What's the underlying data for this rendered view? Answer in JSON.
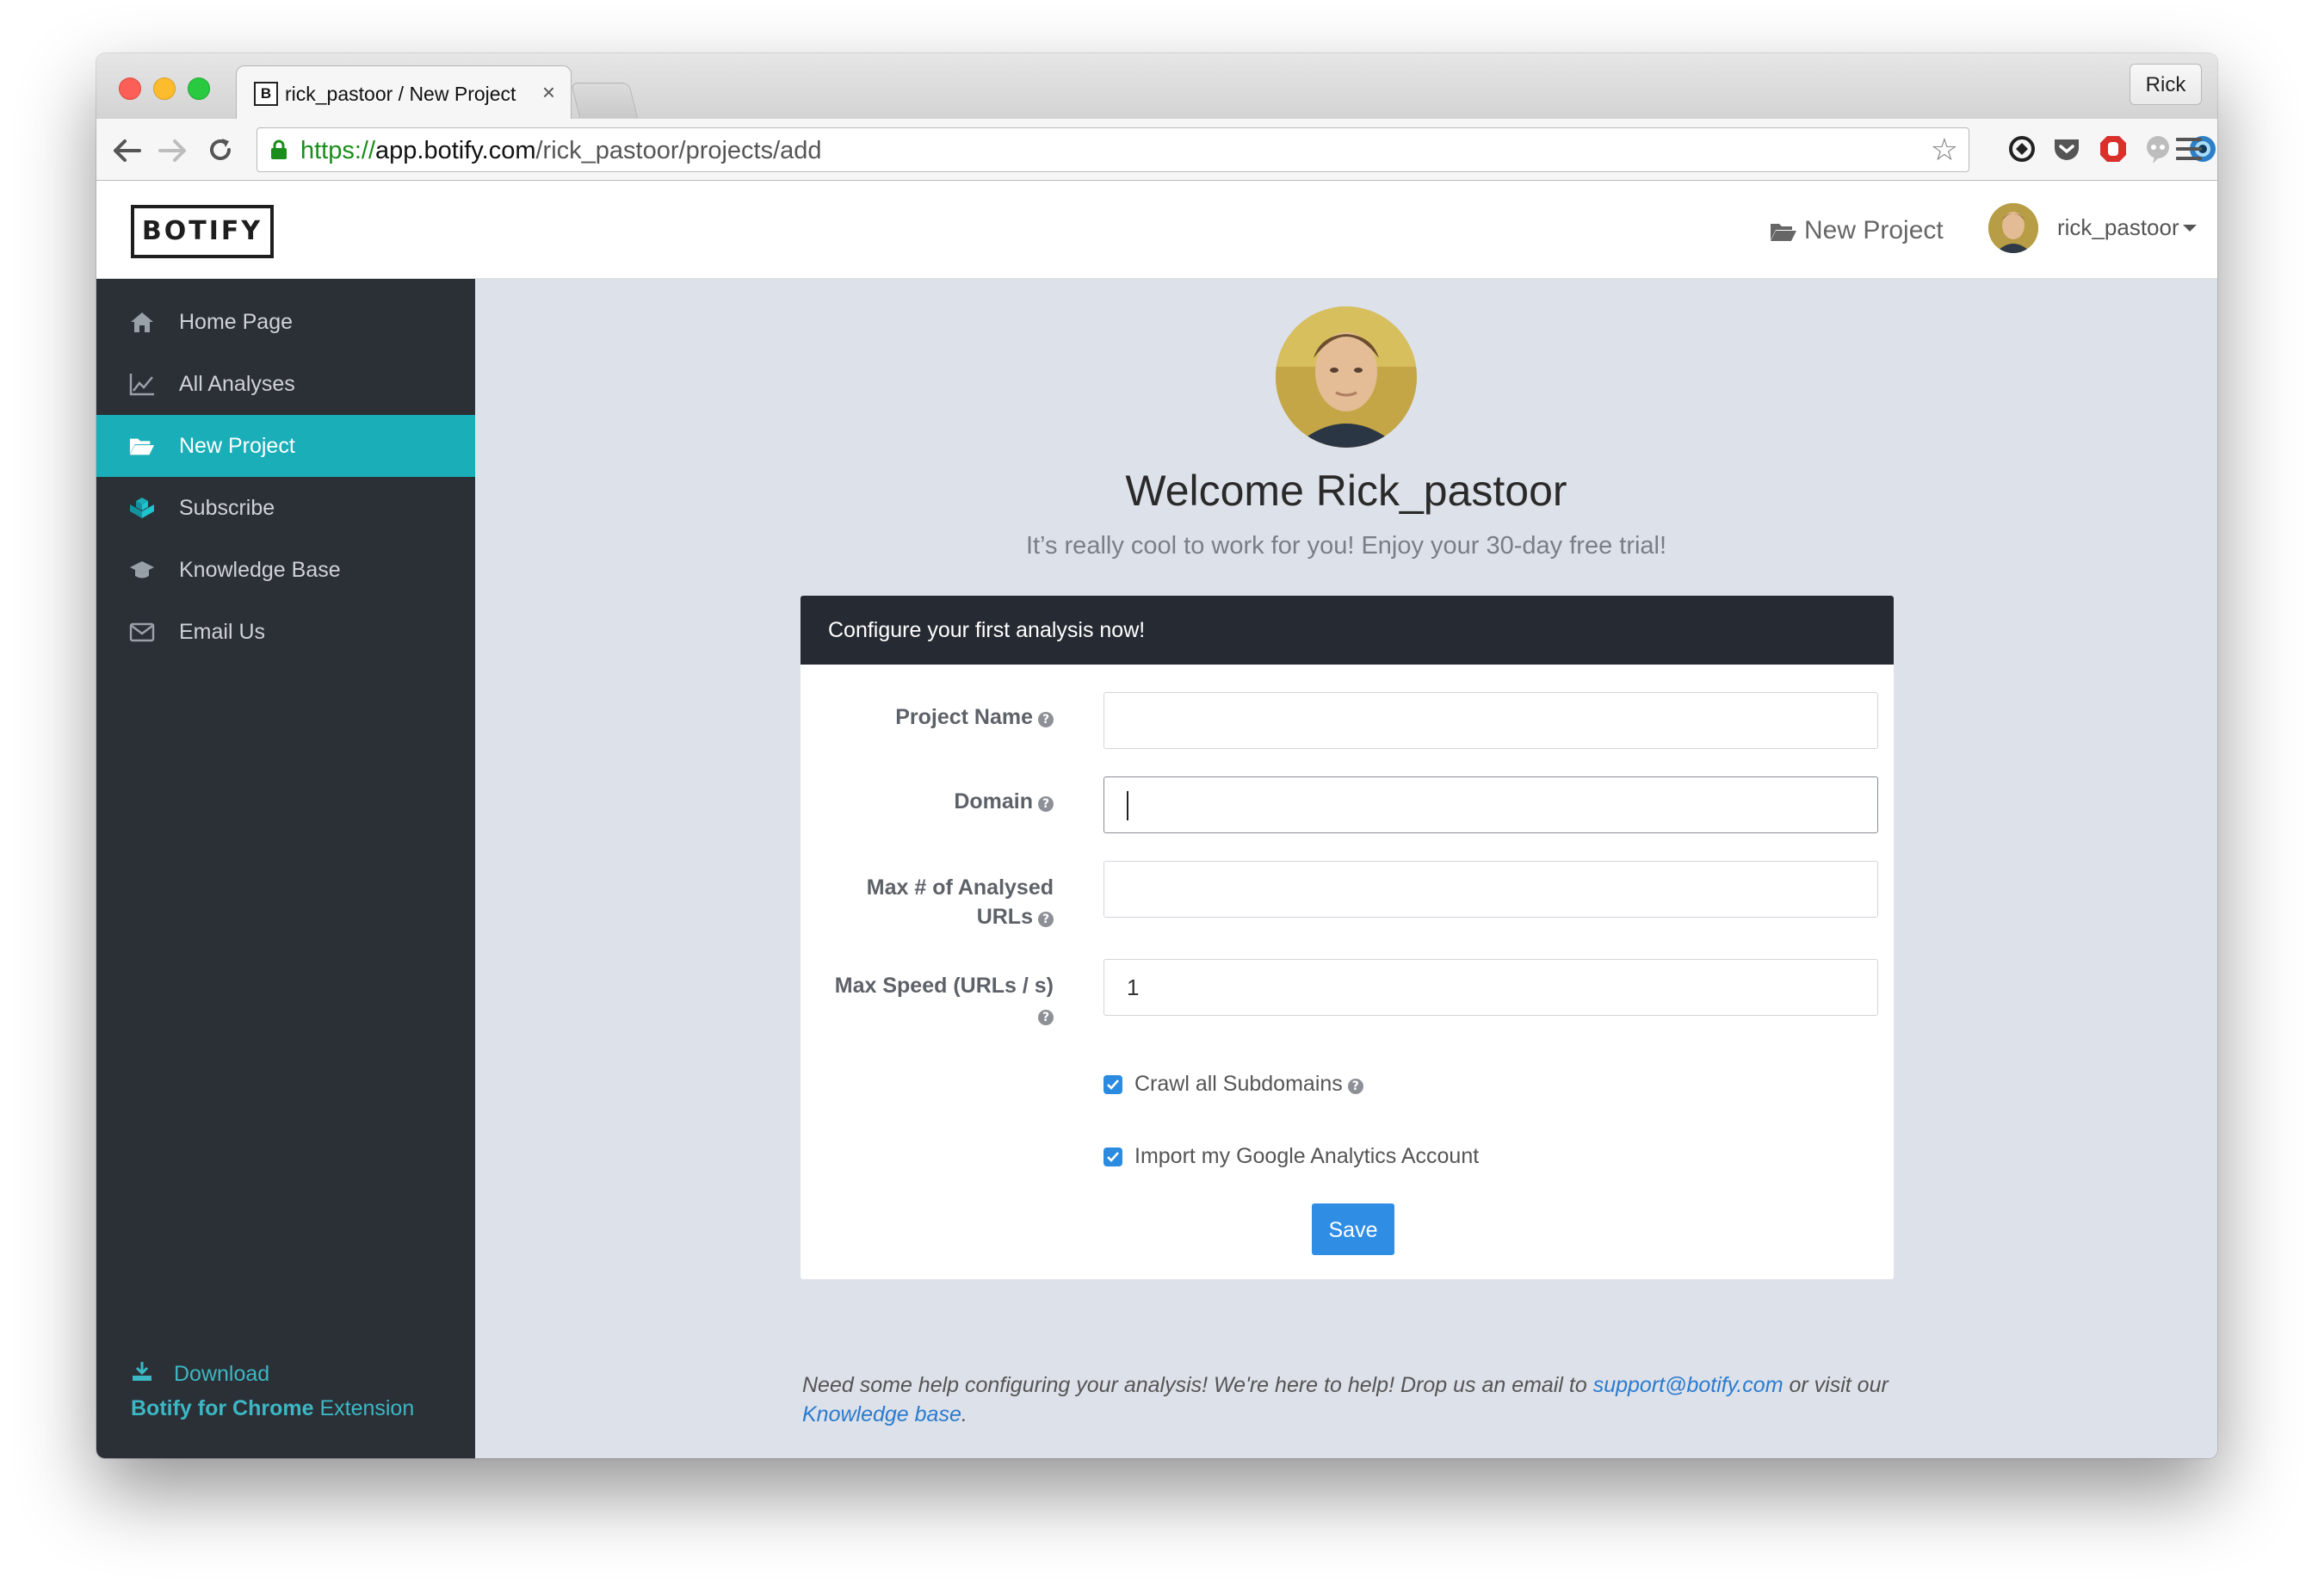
{
  "browser": {
    "tab_title": "rick_pastoor / New Project",
    "tab_favicon": "B",
    "tab_close": "×",
    "profile_name": "Rick",
    "url_scheme": "https://",
    "url_host": "app.botify.com",
    "url_path": "/rick_pastoor/projects/add",
    "star": "☆"
  },
  "header": {
    "logo": "BOTIFY",
    "new_project": "New Project",
    "username": "rick_pastoor"
  },
  "sidebar": {
    "items": [
      {
        "label": "Home Page",
        "icon": "home-icon"
      },
      {
        "label": "All Analyses",
        "icon": "chart-icon"
      },
      {
        "label": "New Project",
        "icon": "folder-open-icon",
        "active": true
      },
      {
        "label": "Subscribe",
        "icon": "cubes-icon"
      },
      {
        "label": "Knowledge Base",
        "icon": "graduation-cap-icon"
      },
      {
        "label": "Email Us",
        "icon": "envelope-icon"
      }
    ],
    "download_label": "Download",
    "extension_bold": "Botify for Chrome",
    "extension_rest": " Extension"
  },
  "main": {
    "welcome": "Welcome Rick_pastoor",
    "tagline": "It’s really cool to work for you! Enjoy your 30-day free trial!",
    "card_title": "Configure your first analysis now!",
    "fields": {
      "project_name": {
        "label": "Project Name",
        "value": ""
      },
      "domain": {
        "label": "Domain",
        "value": ""
      },
      "max_urls": {
        "label_line1": "Max # of Analysed",
        "label_line2": "URLs",
        "value": ""
      },
      "max_speed": {
        "label": "Max Speed (URLs / s)",
        "value": "1"
      }
    },
    "help_glyph": "?",
    "crawl_subdomains": "Crawl all Subdomains",
    "import_ga": "Import my Google Analytics Account",
    "save": "Save",
    "help_prefix": "Need some help configuring your analysis! We're here to help! Drop us an email to ",
    "support_email": "support@botify.com",
    "help_middle": " or visit our ",
    "kb_link": "Knowledge base",
    "help_suffix": "."
  },
  "colors": {
    "sidebar_bg": "#2b2f36",
    "sidebar_active": "#1aaeb8",
    "main_bg": "#dde1e9",
    "primary_button": "#2f8de4",
    "link": "#2a7bd0"
  }
}
